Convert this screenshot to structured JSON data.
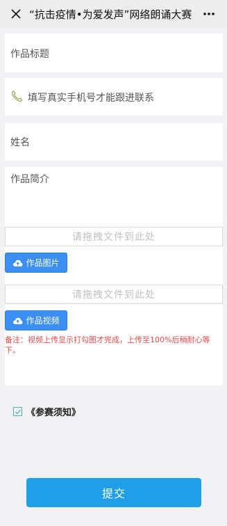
{
  "header": {
    "title": "“抗击疫情•为爱发声”网络朗诵大赛",
    "close_icon": "close-icon",
    "more_icon": "more-icon"
  },
  "form": {
    "title_placeholder": "作品标题",
    "phone_placeholder": "填写真实手机号才能跟进联系",
    "name_placeholder": "姓名",
    "intro_placeholder": "作品简介",
    "image_dropzone": "请拖拽文件到此处",
    "image_button": "作品图片",
    "video_dropzone": "请拖拽文件到此处",
    "video_button": "作品视频",
    "note": "备注：视频上传显示打勾图才完成，上传至100%后稍耐心等下。"
  },
  "agreement": {
    "label": "《参赛须知》",
    "checked": true
  },
  "submit": {
    "label": "提交"
  },
  "colors": {
    "accent": "#1f9fe8",
    "upload_button": "#3b8ff3",
    "note_text": "#e84a4a",
    "background": "#f2f2f4"
  }
}
